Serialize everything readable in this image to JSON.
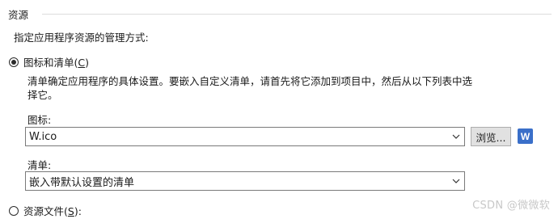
{
  "group": {
    "title": "资源",
    "instruction": "指定应用程序资源的管理方式:"
  },
  "option_icon_manifest": {
    "label": "图标和清单",
    "accel": "C",
    "selected": true,
    "description": "清单确定应用程序的具体设置。要嵌入自定义清单，请首先将它添加到项目中，然后从以下列表中选择它。"
  },
  "icon_field": {
    "label": "图标:",
    "value": "W.ico",
    "browse_label": "浏览...",
    "preview_glyph": "W",
    "preview_color": "#3a6fc9"
  },
  "manifest_field": {
    "label": "清单:",
    "value": "嵌入带默认设置的清单"
  },
  "option_resource_file": {
    "label": "资源文件",
    "accel": "S",
    "suffix": "):",
    "selected": false
  },
  "watermark": "CSDN @微微软"
}
